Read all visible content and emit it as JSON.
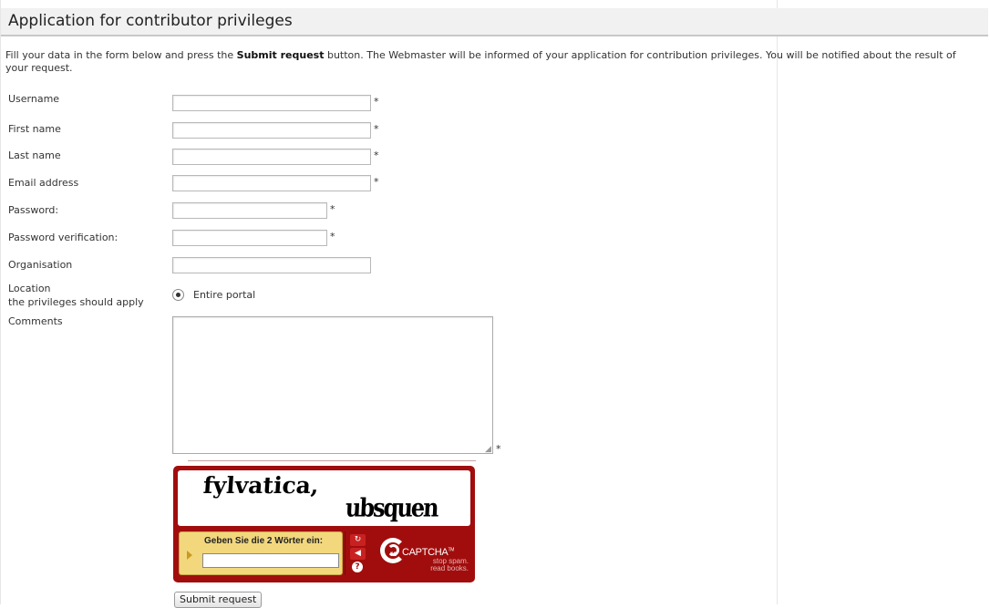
{
  "header": {
    "title": "Application for contributor privileges"
  },
  "intro": {
    "before": "Fill your data in the form below and press the ",
    "bold": "Submit request",
    "after": " button. The Webmaster will be informed of your application for contribution privileges. You will be notified about the result of your request."
  },
  "form": {
    "username": {
      "label": "Username",
      "value": "",
      "required_mark": "*"
    },
    "first_name": {
      "label": "First name",
      "value": "",
      "required_mark": "*"
    },
    "last_name": {
      "label": "Last name",
      "value": "",
      "required_mark": "*"
    },
    "email": {
      "label": "Email address",
      "value": "",
      "required_mark": "*"
    },
    "password": {
      "label": "Password:",
      "value": "",
      "required_mark": "*"
    },
    "password_verification": {
      "label": "Password verification:",
      "value": "",
      "required_mark": "*"
    },
    "organisation": {
      "label": "Organisation",
      "value": ""
    },
    "location": {
      "label_line1": "Location",
      "label_line2": "the privileges should apply",
      "selected_option": "Entire portal"
    },
    "comments": {
      "label": "Comments",
      "value": "",
      "required_mark": "*"
    },
    "submit_label": "Submit request"
  },
  "captcha": {
    "word1": "fylvatica,",
    "word2": "ubsquen",
    "prompt": "Geben Sie die 2 Wörter ein:",
    "response_value": "",
    "brand_prefix": "re",
    "brand": "CAPTCHA",
    "trademark": "TM",
    "tagline_line1": "stop spam.",
    "tagline_line2": "read books.",
    "icons": [
      "refresh-icon",
      "audio-icon",
      "help-icon"
    ]
  }
}
